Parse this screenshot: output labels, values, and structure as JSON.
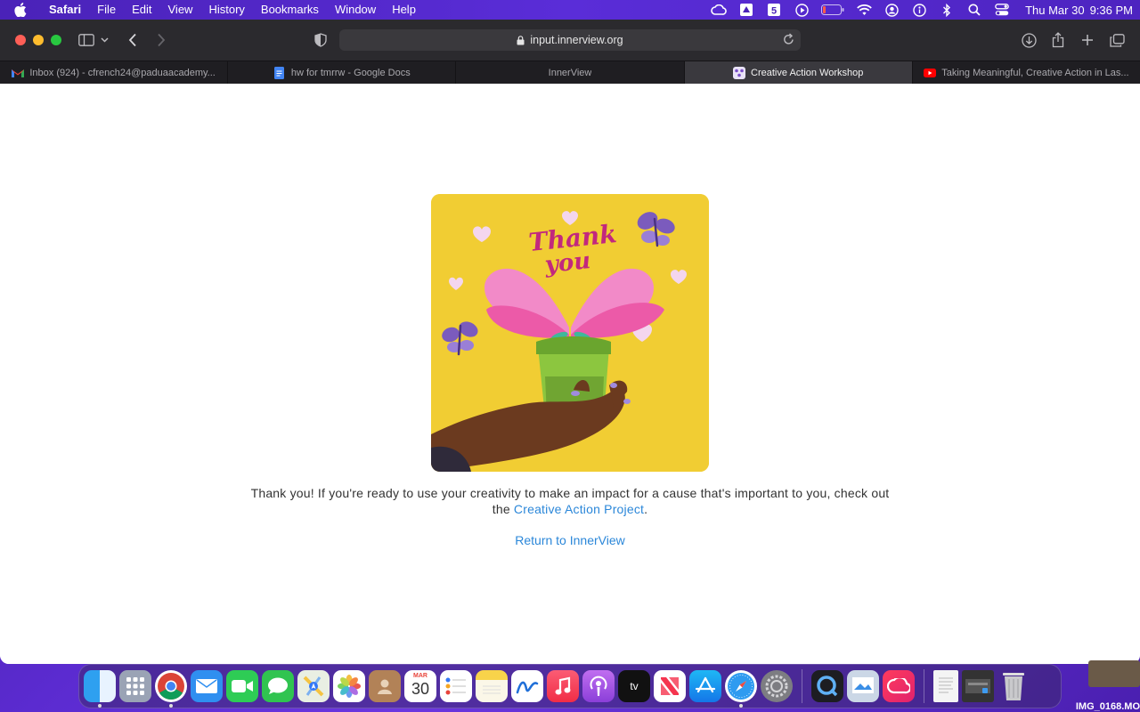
{
  "menubar": {
    "app_name": "Safari",
    "items": [
      "File",
      "Edit",
      "View",
      "History",
      "Bookmarks",
      "Window",
      "Help"
    ],
    "clock_day": "Thu Mar 30",
    "clock_time": "9:36 PM"
  },
  "browser": {
    "url": "input.innerview.org",
    "tabs": [
      {
        "label": "Inbox (924) - cfrench24@paduaacademy...",
        "icon": "gmail-icon",
        "active": false
      },
      {
        "label": "hw for tmrrw - Google Docs",
        "icon": "google-docs-icon",
        "active": false
      },
      {
        "label": "InnerView",
        "icon": "",
        "active": false
      },
      {
        "label": "Creative Action Workshop",
        "icon": "innerview-icon",
        "active": true
      },
      {
        "label": "Taking Meaningful, Creative Action in Las...",
        "icon": "youtube-icon",
        "active": false
      }
    ]
  },
  "page": {
    "image_text_1": "Thank",
    "image_text_2": "you",
    "message_prefix": "Thank you! If you're ready to use your creativity to make an impact for a cause that's important to you, check out the ",
    "message_link": "Creative Action Project",
    "message_suffix": ".",
    "return_link": "Return to InnerView"
  },
  "dock": {
    "calendar_month": "MAR",
    "calendar_day": "30",
    "tv_label": "tv",
    "desktop_file_label": "IMG_0168.MO"
  },
  "colors": {
    "accent_link": "#2b87d9",
    "card_background": "#f1cd33",
    "desktop": "#5b2bd0"
  }
}
